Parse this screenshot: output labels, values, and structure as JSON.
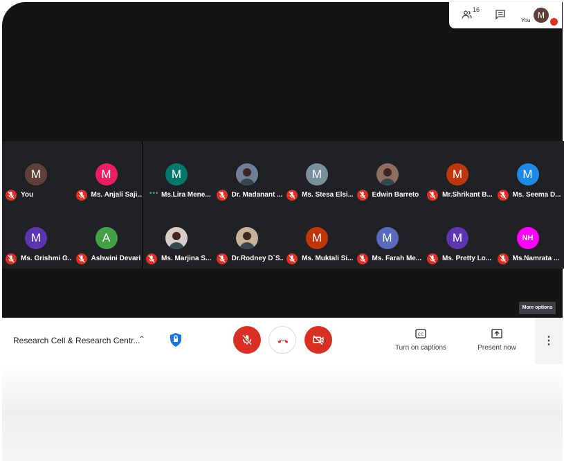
{
  "topbar": {
    "people_count": "16",
    "you_label": "You",
    "avatar_letter": "M"
  },
  "participants": [
    {
      "name": "You",
      "letter": "M",
      "color": "#5d4037",
      "mic": "off"
    },
    {
      "name": "Ms. Anjali Saji...",
      "letter": "M",
      "color": "#e91e63",
      "mic": "off"
    },
    {
      "name": "Ms.Lira Mene...",
      "letter": "M",
      "color": "#00796b",
      "mic": "speaking"
    },
    {
      "name": "Dr. Madanant ...",
      "photo": true,
      "color": "#6d7f99",
      "mic": "off"
    },
    {
      "name": "Ms. Stesa Elsi...",
      "letter": "M",
      "color": "#78909c",
      "mic": "off"
    },
    {
      "name": "Edwin Barreto",
      "photo": true,
      "color": "#8d6e63",
      "mic": "off"
    },
    {
      "name": "Mr.Shrikant B...",
      "letter": "M",
      "color": "#bf360c",
      "mic": "off"
    },
    {
      "name": "Ms. Seema D...",
      "letter": "M",
      "color": "#1e88e5",
      "mic": "off"
    },
    {
      "name": "Ms. Grishmi G...",
      "letter": "M",
      "color": "#5e35b1",
      "mic": "off"
    },
    {
      "name": "Ashwini Devari",
      "letter": "A",
      "color": "#43a047",
      "mic": "off"
    },
    {
      "name": "Ms. Marjina S...",
      "photo": true,
      "color": "#d7ccc8",
      "mic": "off"
    },
    {
      "name": "Dr.Rodney D`S...",
      "photo": true,
      "color": "#c7b299",
      "mic": "off"
    },
    {
      "name": "Ms. Muktali Si...",
      "letter": "M",
      "color": "#bf360c",
      "mic": "off"
    },
    {
      "name": "Ms. Farah Me...",
      "letter": "M",
      "color": "#5c6bc0",
      "mic": "off"
    },
    {
      "name": "Ms. Pretty Lo...",
      "letter": "M",
      "color": "#5e35b1",
      "mic": "off"
    },
    {
      "name": "Ms.Namrata ...",
      "letter": "NH",
      "color": "#ff00ff",
      "mic": "off"
    }
  ],
  "more_options": "More options",
  "bottombar": {
    "meeting_title": "Research Cell & Research Centr...",
    "captions_label": "Turn on captions",
    "present_label": "Present now"
  },
  "colors": {
    "danger": "#d93025",
    "accent": "#1a73e8",
    "dark": "#202124"
  }
}
